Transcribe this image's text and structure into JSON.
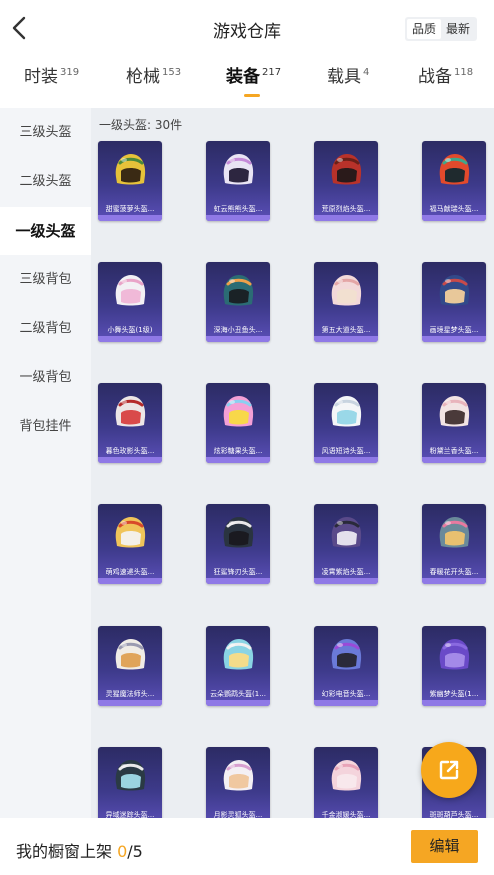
{
  "header": {
    "title": "游戏仓库",
    "back_icon": "chevron-left-icon",
    "sort": [
      {
        "label": "品质",
        "active": true
      },
      {
        "label": "最新",
        "active": false
      }
    ]
  },
  "tabs": [
    {
      "label": "时装",
      "count": "319",
      "active": false
    },
    {
      "label": "枪械",
      "count": "153",
      "active": false
    },
    {
      "label": "装备",
      "count": "217",
      "active": true
    },
    {
      "label": "载具",
      "count": "4",
      "active": false
    },
    {
      "label": "战备",
      "count": "118",
      "active": false
    }
  ],
  "sidebar": {
    "items": [
      {
        "label": "三级头盔",
        "active": false
      },
      {
        "label": "二级头盔",
        "active": false
      },
      {
        "label": "一级头盔",
        "active": true
      },
      {
        "label": "三级背包",
        "active": false
      },
      {
        "label": "二级背包",
        "active": false
      },
      {
        "label": "一级背包",
        "active": false
      },
      {
        "label": "背包挂件",
        "active": false
      }
    ]
  },
  "section": {
    "title": "一级头盔: 30件"
  },
  "items": [
    {
      "name": "甜蜜菠萝头盔...",
      "shell": "#e6c23a",
      "visor": "#3a2a14",
      "accent": "#4a8a3a"
    },
    {
      "name": "虹云熊熊头盔...",
      "shell": "#e9e4f4",
      "visor": "#2d2640",
      "accent": "#c58ad8"
    },
    {
      "name": "荒原烈焰头盔...",
      "shell": "#b8322a",
      "visor": "#2a1a1a",
      "accent": "#6a2018"
    },
    {
      "name": "福马献瑞头盔...",
      "shell": "#e24a2c",
      "visor": "#1f2a2e",
      "accent": "#3fa78a"
    },
    {
      "name": "小舞头盔(1级)",
      "shell": "#f2f0f4",
      "visor": "#f0b9d8",
      "accent": "#e9a4c8"
    },
    {
      "name": "深海小丑鱼头...",
      "shell": "#2b6c74",
      "visor": "#1a2226",
      "accent": "#f0a04a"
    },
    {
      "name": "第五大道头盔...",
      "shell": "#f3d9d9",
      "visor": "#f2e0d0",
      "accent": "#e4a6a6"
    },
    {
      "name": "画境星梦头盔...",
      "shell": "#324a8a",
      "visor": "#e8c89a",
      "accent": "#c84a4a"
    },
    {
      "name": "暮色玫影头盔...",
      "shell": "#ece6e6",
      "visor": "#d94a4a",
      "accent": "#b52a2a"
    },
    {
      "name": "炫彩糖果头盔...",
      "shell": "#f4a0d6",
      "visor": "#f8d84a",
      "accent": "#8ad0f0"
    },
    {
      "name": "风语短诗头盔...",
      "shell": "#f4f6f8",
      "visor": "#9ad8e8",
      "accent": "#c8d4e0"
    },
    {
      "name": "粉黛兰香头盔...",
      "shell": "#f2e4e4",
      "visor": "#4a3a3a",
      "accent": "#e8b4bc"
    },
    {
      "name": "萌鸡速递头盔...",
      "shell": "#f0c45a",
      "visor": "#f4f0e8",
      "accent": "#d84a2a"
    },
    {
      "name": "狂鲨锋刃头盔...",
      "shell": "#2a3440",
      "visor": "#1a1a20",
      "accent": "#e8e8e8"
    },
    {
      "name": "凌霄紫焰头盔...",
      "shell": "#5a4a8a",
      "visor": "#e4e0ec",
      "accent": "#2a2a3a"
    },
    {
      "name": "春暖花开头盔...",
      "shell": "#6a8a9a",
      "visor": "#e8c070",
      "accent": "#e87aa0"
    },
    {
      "name": "灵猩魔法师头...",
      "shell": "#f0ece6",
      "visor": "#e0a45a",
      "accent": "#9a9ab0"
    },
    {
      "name": "云朵鹦鹉头盔(1...",
      "shell": "#8ad4e4",
      "visor": "#f4dc8a",
      "accent": "#f0f0f0"
    },
    {
      "name": "幻彩电音头盔...",
      "shell": "#6a7ad8",
      "visor": "#2a2a3a",
      "accent": "#9a4ad8"
    },
    {
      "name": "紫幽梦头盔(1...",
      "shell": "#6a4ac8",
      "visor": "#a48ae8",
      "accent": "#8a6ae0"
    },
    {
      "name": "异域迷踪头盔...",
      "shell": "#2a3a44",
      "visor": "#9ad4e0",
      "accent": "#e8e8e8"
    },
    {
      "name": "月影灵狐头盔...",
      "shell": "#f4f0f4",
      "visor": "#f0c8a0",
      "accent": "#d8a0d0"
    },
    {
      "name": "千金淑媛头盔...",
      "shell": "#f4d4dc",
      "visor": "#f8e8ec",
      "accent": "#e8a4b8"
    },
    {
      "name": "斑斑葫芦头盔...",
      "shell": "#3a3030",
      "visor": "#f4f0f0",
      "accent": "#e87a8a"
    }
  ],
  "share_button": {
    "icon": "share-external-icon"
  },
  "footer": {
    "label": "我的橱窗上架 ",
    "current": "0",
    "total": "/5",
    "edit_label": "编辑"
  },
  "colors": {
    "accent": "#f5a623",
    "card_top": "#2c2b64",
    "card_bottom": "#8f79e6",
    "sidebar_bg": "#f3f5f8",
    "content_bg": "#ebeef2"
  }
}
